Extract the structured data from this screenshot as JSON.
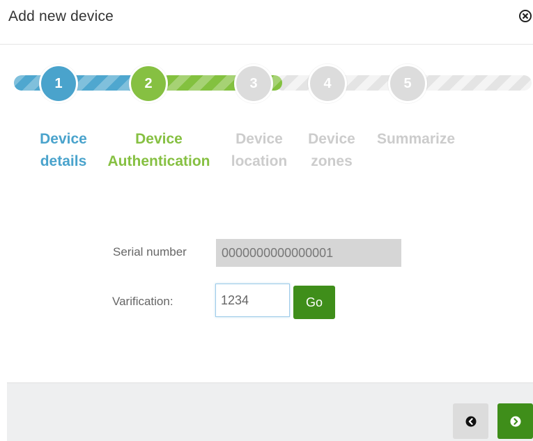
{
  "dialog": {
    "title": "Add new device"
  },
  "stepper": {
    "steps": [
      {
        "number": "1",
        "label_line1": "Device",
        "label_line2": "details",
        "state": "completed"
      },
      {
        "number": "2",
        "label_line1": "Device",
        "label_line2": "Authentication",
        "state": "current"
      },
      {
        "number": "3",
        "label_line1": "Device",
        "label_line2": "location",
        "state": "pending"
      },
      {
        "number": "4",
        "label_line1": "Device",
        "label_line2": "zones",
        "state": "pending"
      },
      {
        "number": "5",
        "label_line1": "Summarize",
        "label_line2": "",
        "state": "pending"
      }
    ],
    "colors": {
      "completed": "#4aa3cc",
      "current": "#86c042",
      "pending": "#dcdcdc"
    }
  },
  "form": {
    "serial_label": "Serial number",
    "serial_value": "0000000000000001",
    "verification_label": "Varification:",
    "verification_value": "1234",
    "go_label": "Go"
  },
  "footer": {
    "prev_icon": "arrow-left-icon",
    "next_icon": "arrow-right-icon",
    "accent": "#3f8e1a"
  }
}
